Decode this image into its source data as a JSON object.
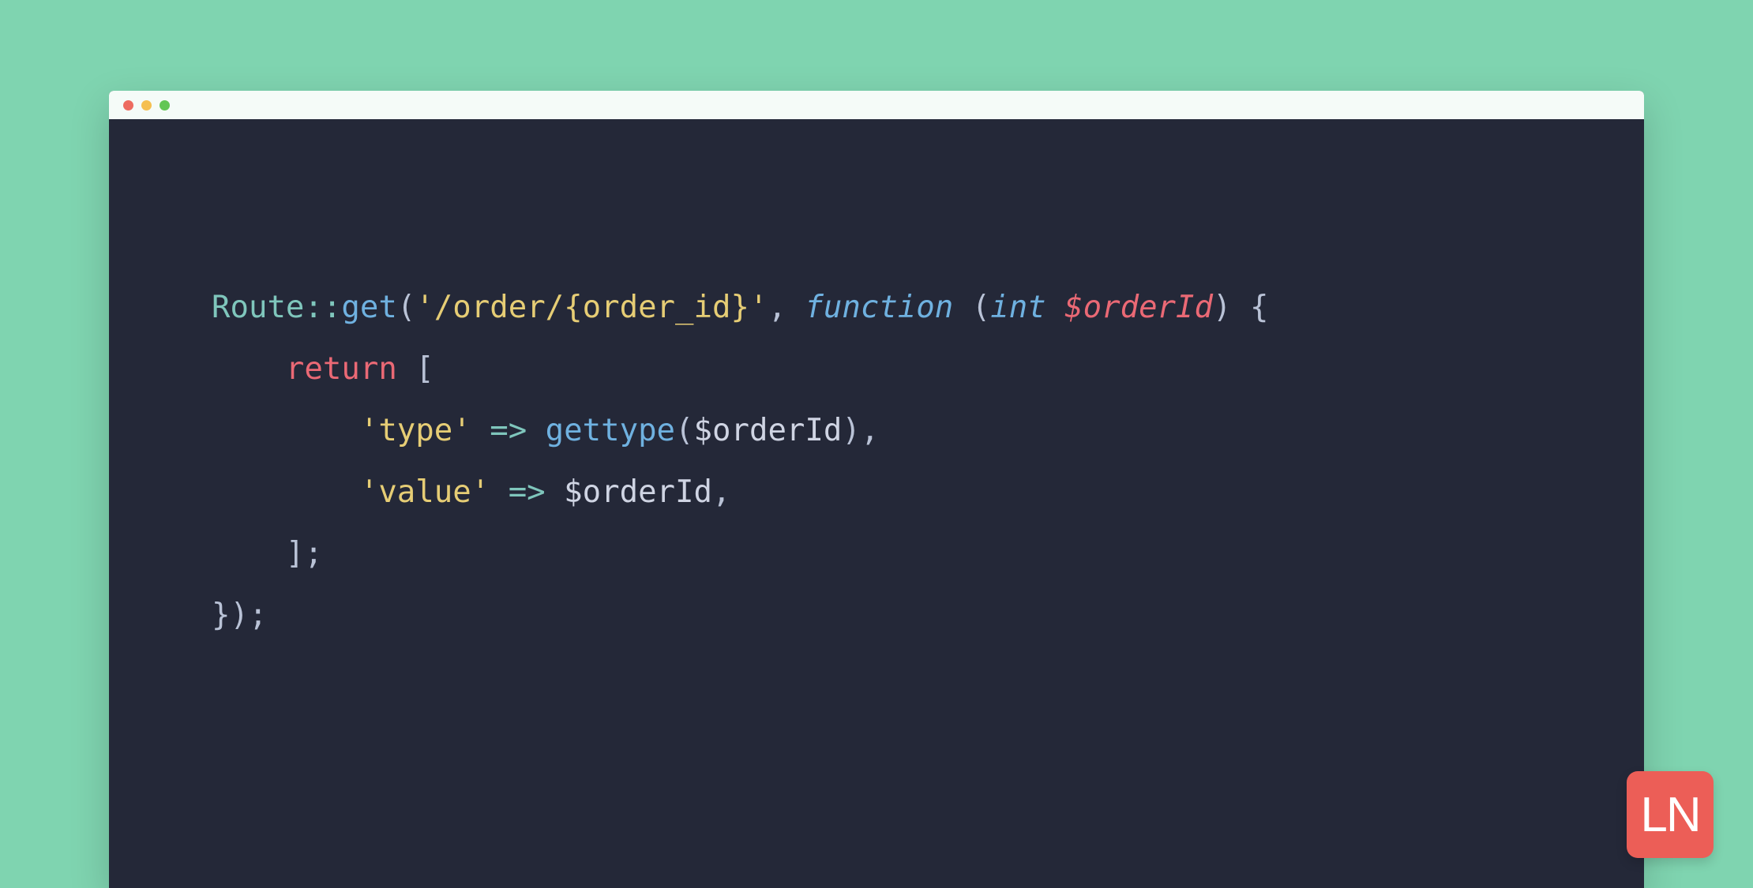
{
  "window": {
    "traffic_icons": [
      "close",
      "minimize",
      "zoom"
    ]
  },
  "code": {
    "line1": {
      "class": "Route",
      "op": "::",
      "method": "get",
      "lparen": "(",
      "str": "'/order/{order_id}'",
      "comma": ", ",
      "kw_function": "function",
      "sp1": " ",
      "lparen2": "(",
      "type": "int",
      "sp2": " ",
      "dollar": "$",
      "var": "orderId",
      "rparen2": ")",
      "sp3": " ",
      "lbrace": "{"
    },
    "line2": {
      "indent": "    ",
      "kw_return": "return",
      "sp": " ",
      "lbracket": "["
    },
    "line3": {
      "indent": "        ",
      "key": "'type'",
      "sp1": " ",
      "arrow": "=>",
      "sp2": " ",
      "func": "gettype",
      "lparen": "(",
      "dollar": "$",
      "var": "orderId",
      "rparen": ")",
      "comma": ","
    },
    "line4": {
      "indent": "        ",
      "key": "'value'",
      "sp1": " ",
      "arrow": "=>",
      "sp2": " ",
      "dollar": "$",
      "var": "orderId",
      "comma": ","
    },
    "line5": {
      "indent": "    ",
      "rbracket": "]",
      "semi": ";"
    },
    "line6": {
      "rbrace": "}",
      "rparen": ")",
      "semi": ";"
    }
  },
  "logo": {
    "text": "LN",
    "bg": "#ec5e57"
  }
}
